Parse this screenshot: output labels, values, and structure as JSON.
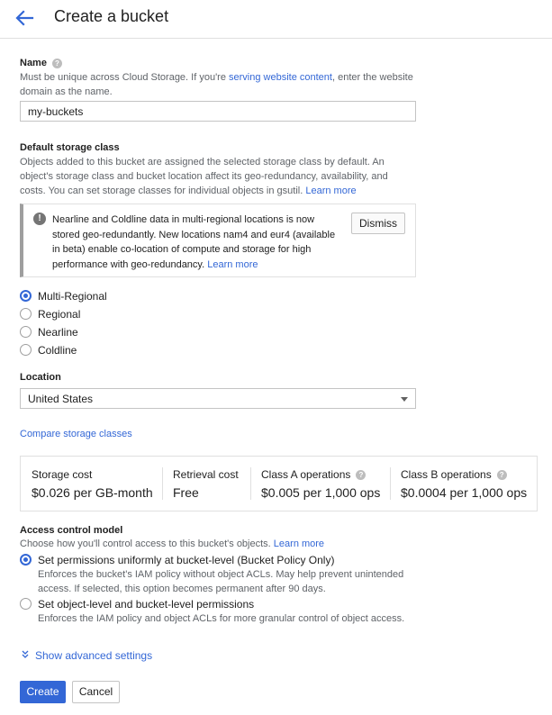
{
  "header": {
    "title": "Create a bucket"
  },
  "name_section": {
    "label": "Name",
    "help_prefix": "Must be unique across Cloud Storage. If you're ",
    "help_link": "serving website content",
    "help_suffix_1": ", enter the website",
    "help_suffix_2": "domain as the name.",
    "value": "my-buckets"
  },
  "storage_class": {
    "label": "Default storage class",
    "help_line1": "Objects added to this bucket are assigned the selected storage class by default. An",
    "help_line2": "object's storage class and bucket location affect its geo-redundancy, availability, and",
    "help_line3": "costs. You can set storage classes for individual objects in gsutil.",
    "help_link": "Learn more",
    "info": {
      "line1": "Nearline and Coldline data in multi-regional locations is now",
      "line2": "stored geo-redundantly. New locations nam4 and eur4 (available",
      "line3": "in beta) enable co-location of compute and storage for high",
      "line4": "performance with geo-redundancy.",
      "link": "Learn more",
      "dismiss_label": "Dismiss"
    },
    "options": [
      {
        "label": "Multi-Regional",
        "checked": true
      },
      {
        "label": "Regional",
        "checked": false
      },
      {
        "label": "Nearline",
        "checked": false
      },
      {
        "label": "Coldline",
        "checked": false
      }
    ]
  },
  "location": {
    "label": "Location",
    "value": "United States"
  },
  "compare_link": "Compare storage classes",
  "costs": [
    {
      "header": "Storage cost",
      "value": "$0.026 per GB-month",
      "help": false
    },
    {
      "header": "Retrieval cost",
      "value": "Free",
      "help": false
    },
    {
      "header": "Class A operations",
      "value": "$0.005 per 1,000 ops",
      "help": true
    },
    {
      "header": "Class B operations",
      "value": "$0.0004 per 1,000 ops",
      "help": true
    }
  ],
  "access_control": {
    "label": "Access control model",
    "help": "Choose how you'll control access to this bucket's objects.",
    "help_link": "Learn more",
    "options": [
      {
        "label": "Set permissions uniformly at bucket-level (Bucket Policy Only)",
        "desc_line1": "Enforces the bucket's IAM policy without object ACLs. May help prevent unintended",
        "desc_line2": "access. If selected, this option becomes permanent after 90 days.",
        "checked": true
      },
      {
        "label": "Set object-level and bucket-level permissions",
        "desc_line1": "Enforces the IAM policy and object ACLs for more granular control of object access.",
        "checked": false
      }
    ]
  },
  "advanced_link": "Show advanced settings",
  "actions": {
    "create_label": "Create",
    "cancel_label": "Cancel"
  },
  "colors": {
    "accent": "#3367d6",
    "text": "#212121",
    "muted": "#5f6368",
    "border": "#e0e0e0"
  },
  "icons": {
    "back": "arrow-left-icon",
    "help": "help-circle-icon",
    "info": "info-circle-icon",
    "dropdown": "caret-down-icon",
    "advanced": "double-chevron-down-icon"
  }
}
